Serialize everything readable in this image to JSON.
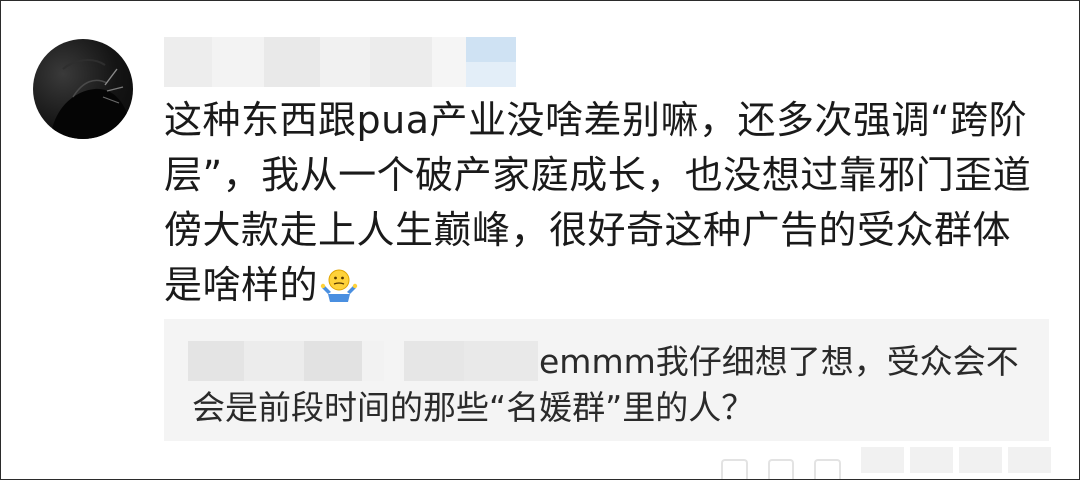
{
  "comment": {
    "text": "这种东西跟pua产业没啥差别嘛，还多次强调“跨阶层”，我从一个破产家庭成长，也没想过靠邪门歪道傍大款走上人生巅峰，很好奇这种广告的受众群体是啥样的",
    "emoji": "shrug-emoji"
  },
  "reply": {
    "text": "emmm我仔细想了想，受众会不会是前段时间的那些“名媛群”里的人？"
  },
  "colors": {
    "text": "#1a1a1a",
    "reply_bg": "#f4f4f4",
    "blur_light": "#eeeeee",
    "blur_blue": "#d9e8f5"
  }
}
